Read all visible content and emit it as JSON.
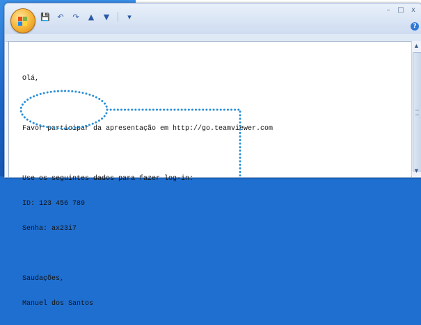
{
  "window": {
    "controls": {
      "minimize": "–",
      "maximize": "□",
      "close": "x"
    },
    "help": "?"
  },
  "qat": {
    "save": "💾",
    "undo": "↶",
    "redo": "↷",
    "up": "▲",
    "down": "▼",
    "customize": "▾"
  },
  "email": {
    "greeting": "Olá,",
    "line1": "Favor participar da apresentação em http://go.teamviewer.com",
    "line2": "Use os seguintes dados para fazer log-in:",
    "line3": "ID: 123 456 789",
    "line4": "Senha: ax23i7",
    "closing": "Saudações,",
    "signature": "Manuel dos Santos"
  },
  "colors": {
    "annotation": "#2b8fd6",
    "desktop": "#1f6fd0"
  }
}
